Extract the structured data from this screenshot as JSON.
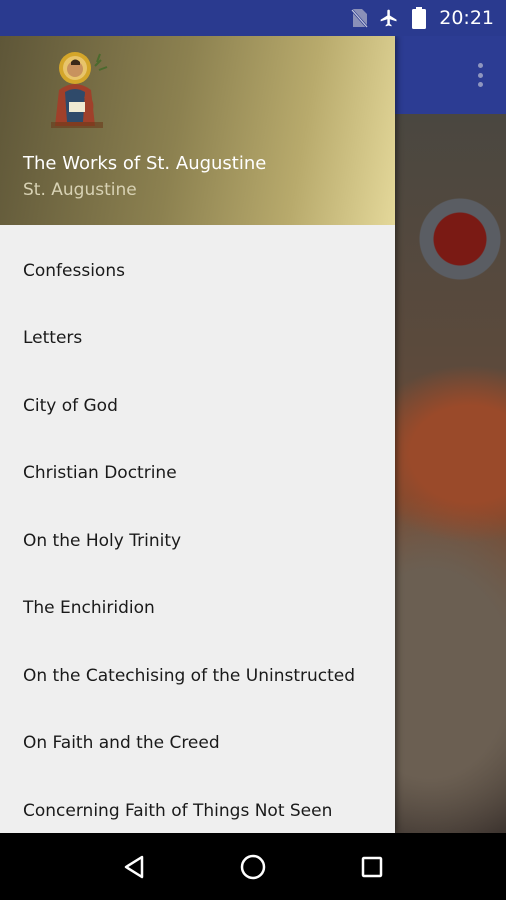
{
  "status_bar": {
    "time": "20:21",
    "icons": [
      "no-sim-icon",
      "airplane-icon",
      "battery-icon"
    ]
  },
  "app": {
    "toolbar_color": "#2c3c93",
    "overflow_icon": "overflow-menu-icon"
  },
  "drawer": {
    "header": {
      "title": "The Works of St. Augustine",
      "subtitle": "St. Augustine",
      "avatar_icon": "saint-icon"
    },
    "items": [
      {
        "label": "Confessions"
      },
      {
        "label": "Letters"
      },
      {
        "label": "City of God"
      },
      {
        "label": "Christian Doctrine"
      },
      {
        "label": "On the Holy Trinity"
      },
      {
        "label": "The Enchiridion"
      },
      {
        "label": "On the Catechising of the Uninstructed"
      },
      {
        "label": "On Faith and the Creed"
      },
      {
        "label": "Concerning Faith of Things Not Seen"
      }
    ]
  },
  "nav_bar": {
    "buttons": [
      "back-icon",
      "home-icon",
      "recents-icon"
    ]
  }
}
